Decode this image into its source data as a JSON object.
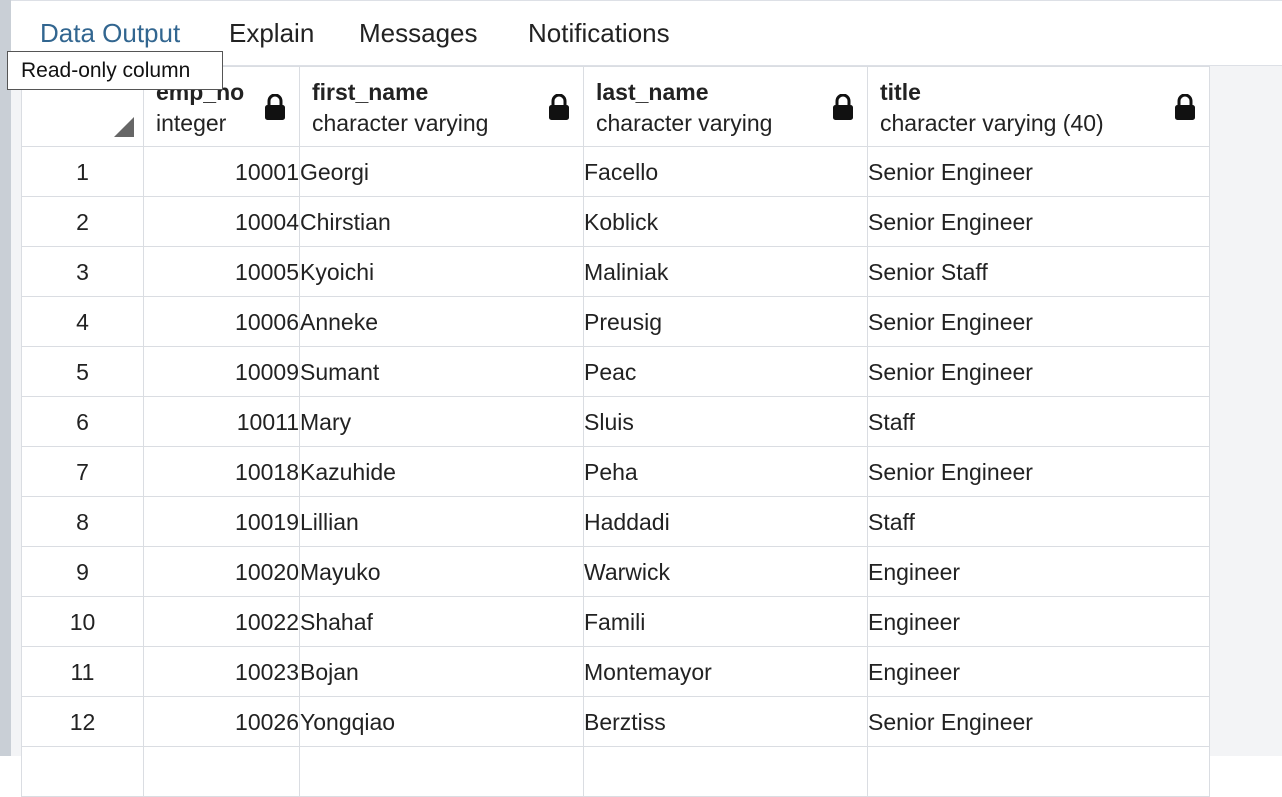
{
  "tabs": [
    {
      "label": "Data Output",
      "active": true
    },
    {
      "label": "Explain",
      "active": false
    },
    {
      "label": "Messages",
      "active": false
    },
    {
      "label": "Notifications",
      "active": false
    }
  ],
  "tooltip": {
    "text": "Read-only column"
  },
  "columns": [
    {
      "name": "emp_no",
      "type": "integer",
      "icon": "lock-icon"
    },
    {
      "name": "first_name",
      "type": "character varying",
      "icon": "lock-icon"
    },
    {
      "name": "last_name",
      "type": "character varying",
      "icon": "lock-icon"
    },
    {
      "name": "title",
      "type": "character varying (40)",
      "icon": "lock-icon"
    }
  ],
  "rows": [
    {
      "n": "1",
      "emp_no": "10001",
      "first_name": "Georgi",
      "last_name": "Facello",
      "title": "Senior Engineer"
    },
    {
      "n": "2",
      "emp_no": "10004",
      "first_name": "Chirstian",
      "last_name": "Koblick",
      "title": "Senior Engineer"
    },
    {
      "n": "3",
      "emp_no": "10005",
      "first_name": "Kyoichi",
      "last_name": "Maliniak",
      "title": "Senior Staff"
    },
    {
      "n": "4",
      "emp_no": "10006",
      "first_name": "Anneke",
      "last_name": "Preusig",
      "title": "Senior Engineer"
    },
    {
      "n": "5",
      "emp_no": "10009",
      "first_name": "Sumant",
      "last_name": "Peac",
      "title": "Senior Engineer"
    },
    {
      "n": "6",
      "emp_no": "10011",
      "first_name": "Mary",
      "last_name": "Sluis",
      "title": "Staff"
    },
    {
      "n": "7",
      "emp_no": "10018",
      "first_name": "Kazuhide",
      "last_name": "Peha",
      "title": "Senior Engineer"
    },
    {
      "n": "8",
      "emp_no": "10019",
      "first_name": "Lillian",
      "last_name": "Haddadi",
      "title": "Staff"
    },
    {
      "n": "9",
      "emp_no": "10020",
      "first_name": "Mayuko",
      "last_name": "Warwick",
      "title": "Engineer"
    },
    {
      "n": "10",
      "emp_no": "10022",
      "first_name": "Shahaf",
      "last_name": "Famili",
      "title": "Engineer"
    },
    {
      "n": "11",
      "emp_no": "10023",
      "first_name": "Bojan",
      "last_name": "Montemayor",
      "title": "Engineer"
    },
    {
      "n": "12",
      "emp_no": "10026",
      "first_name": "Yongqiao",
      "last_name": "Berztiss",
      "title": "Senior Engineer"
    },
    {
      "n": "",
      "emp_no": "",
      "first_name": "",
      "last_name": "",
      "title": ""
    }
  ],
  "colors": {
    "active_tab": "#326690",
    "grid_border": "#dadde2",
    "panel_bg": "#f3f4f6"
  }
}
